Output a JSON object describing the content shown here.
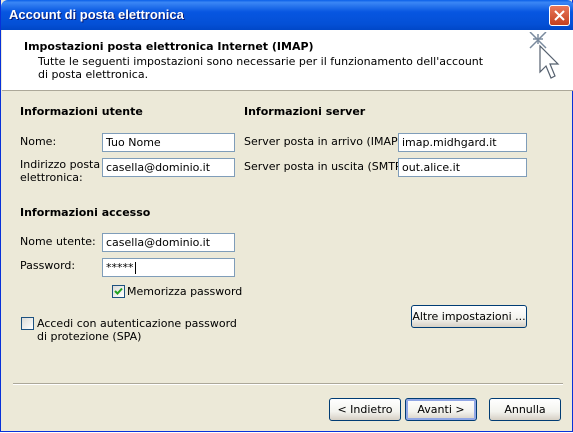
{
  "window": {
    "title": "Account di posta elettronica"
  },
  "header": {
    "title": "Impostazioni posta elettronica Internet (IMAP)",
    "description": "Tutte le seguenti impostazioni sono necessarie per il funzionamento dell'account di posta elettronica."
  },
  "user_info": {
    "heading": "Informazioni utente",
    "name_label": "Nome:",
    "name_value": "Tuo Nome",
    "email_label_line1": "Indirizzo posta",
    "email_label_line2": "elettronica:",
    "email_value": "casella@dominio.it"
  },
  "server_info": {
    "heading": "Informazioni server",
    "incoming_label": "Server posta in arrivo (IMAP):",
    "incoming_value": "imap.midhgard.it",
    "outgoing_label": "Server posta in uscita (SMTP):",
    "outgoing_value": "out.alice.it"
  },
  "access_info": {
    "heading": "Informazioni accesso",
    "username_label": "Nome utente:",
    "username_value": "casella@dominio.it",
    "password_label": "Password:",
    "password_value": "*****",
    "remember_label": "Memorizza password",
    "remember_checked": true,
    "spa_label_line1": "Accedi con autenticazione password",
    "spa_label_line2": "di protezione (SPA)",
    "spa_checked": false
  },
  "buttons": {
    "more_settings": "Altre impostazioni ...",
    "back": "< Indietro",
    "next": "Avanti >",
    "cancel": "Annulla"
  },
  "colors": {
    "titlebar": "#0756e1",
    "dialog_bg": "#ece9d8",
    "close_button": "#c4401f",
    "input_border": "#7f9db9",
    "check_mark": "#21a121"
  },
  "icons": {
    "close": "close-icon",
    "wizard": "cursor-sparkle-icon",
    "check": "check-icon"
  }
}
